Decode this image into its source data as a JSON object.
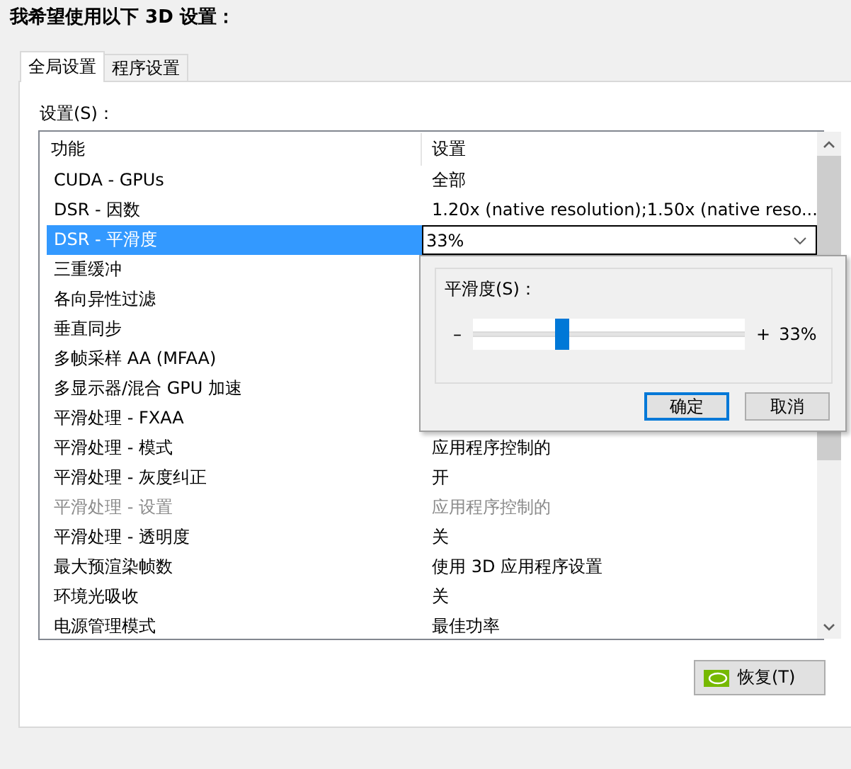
{
  "heading": "我希望使用以下 3D 设置：",
  "tabs": [
    {
      "label": "全局设置",
      "selected": true
    },
    {
      "label": "程序设置",
      "selected": false
    }
  ],
  "settings_label": "设置(S)：",
  "table": {
    "columns": [
      "功能",
      "设置"
    ],
    "rows": [
      {
        "feature": "CUDA - GPUs",
        "value": "全部",
        "kind": "text",
        "selected": false,
        "disabled": false
      },
      {
        "feature": "DSR - 因数",
        "value": "1.20x (native resolution);1.50x (native reso...",
        "kind": "text",
        "selected": false,
        "disabled": false
      },
      {
        "feature": "DSR - 平滑度",
        "value": "33%",
        "kind": "dropdown",
        "selected": true,
        "disabled": false
      },
      {
        "feature": "三重缓冲",
        "kind": "text",
        "selected": false,
        "disabled": false
      },
      {
        "feature": "各向异性过滤",
        "kind": "text",
        "selected": false,
        "disabled": false
      },
      {
        "feature": "垂直同步",
        "kind": "text",
        "selected": false,
        "disabled": false
      },
      {
        "feature": "多帧采样 AA (MFAA)",
        "kind": "text",
        "selected": false,
        "disabled": false
      },
      {
        "feature": "多显示器/混合 GPU 加速",
        "kind": "text",
        "selected": false,
        "disabled": false
      },
      {
        "feature": "平滑处理 - FXAA",
        "kind": "text",
        "selected": false,
        "disabled": false
      },
      {
        "feature": "平滑处理 - 模式",
        "value": "应用程序控制的",
        "kind": "text",
        "selected": false,
        "disabled": false
      },
      {
        "feature": "平滑处理 - 灰度纠正",
        "value": "开",
        "kind": "text",
        "selected": false,
        "disabled": false
      },
      {
        "feature": "平滑处理 - 设置",
        "value": "应用程序控制的",
        "kind": "text",
        "selected": false,
        "disabled": true
      },
      {
        "feature": "平滑处理 - 透明度",
        "value": "关",
        "kind": "text",
        "selected": false,
        "disabled": false
      },
      {
        "feature": "最大预渲染帧数",
        "value": "使用 3D 应用程序设置",
        "kind": "text",
        "selected": false,
        "disabled": false
      },
      {
        "feature": "环境光吸收",
        "value": "关",
        "kind": "text",
        "selected": false,
        "disabled": false
      },
      {
        "feature": "电源管理模式",
        "value": "最佳功率",
        "kind": "text",
        "selected": false,
        "disabled": false
      }
    ]
  },
  "popup": {
    "label": "平滑度(S)：",
    "minus": "–",
    "plus": "+",
    "slider": {
      "level": 0.33
    },
    "reading": "33%",
    "buttons": [
      {
        "label": "确定",
        "default": true
      },
      {
        "label": "取消",
        "default": false
      }
    ]
  },
  "restore_button": "恢复(T)"
}
